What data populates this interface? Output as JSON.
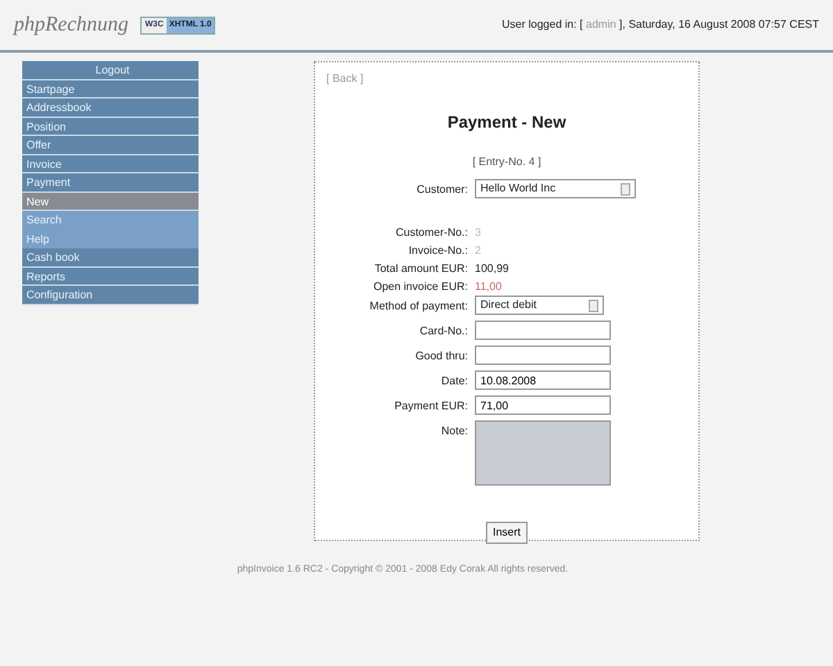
{
  "header": {
    "logo": "phpRechnung",
    "badge_left": "W3C",
    "badge_right": "XHTML 1.0",
    "user_prefix": "User logged in: [",
    "user": "admin",
    "user_suffix": "],",
    "datetime": "Saturday, 16  August 2008 07:57 CEST"
  },
  "sidebar": {
    "logout": "Logout",
    "items": [
      {
        "label": "Startpage",
        "kind": "main",
        "selected": false
      },
      {
        "label": "Addressbook",
        "kind": "main",
        "selected": false
      },
      {
        "label": "Position",
        "kind": "main",
        "selected": false
      },
      {
        "label": "Offer",
        "kind": "main",
        "selected": false
      },
      {
        "label": "Invoice",
        "kind": "main",
        "selected": false
      },
      {
        "label": "Payment",
        "kind": "main",
        "selected": false
      },
      {
        "label": "New",
        "kind": "sub",
        "selected": true
      },
      {
        "label": "Search",
        "kind": "sub",
        "selected": false
      },
      {
        "label": "Help",
        "kind": "sub",
        "selected": false
      },
      {
        "label": "Cash book",
        "kind": "main",
        "selected": false
      },
      {
        "label": "Reports",
        "kind": "main",
        "selected": false
      },
      {
        "label": "Configuration",
        "kind": "main",
        "selected": false
      }
    ]
  },
  "panel": {
    "back": "[ Back ]",
    "title": "Payment - New",
    "entry": "[ Entry-No. 4 ]",
    "fields": [
      {
        "label": "Customer:",
        "kind": "select",
        "value": "Hello World Inc",
        "wide": true
      },
      {
        "kind": "spacer"
      },
      {
        "label": "Customer-No.:",
        "kind": "info",
        "value": "3",
        "color": "#bbbbbb"
      },
      {
        "label": "Invoice-No.:",
        "kind": "info",
        "value": "2",
        "color": "#bbbbbb"
      },
      {
        "label": "Total amount EUR:",
        "kind": "info",
        "value": "100,99",
        "color": "#222222"
      },
      {
        "label": "Open invoice EUR:",
        "kind": "info",
        "value": "11,00",
        "color": "#cc6666"
      },
      {
        "label": "Method of payment:",
        "kind": "select",
        "value": "Direct debit",
        "wide": false
      },
      {
        "label": "Card-No.:",
        "kind": "input"
      },
      {
        "label": "Good thru:",
        "kind": "input"
      },
      {
        "label": "Date:",
        "kind": "input",
        "value": "10.08.2008"
      },
      {
        "label": "Payment EUR:",
        "kind": "input",
        "value": "71,00"
      },
      {
        "label": "Note:",
        "kind": "textarea"
      }
    ],
    "button": "Insert"
  },
  "footer": "phpInvoice 1.6 RC2 - Copyright © 2001 - 2008  Edy Corak  All rights reserved."
}
